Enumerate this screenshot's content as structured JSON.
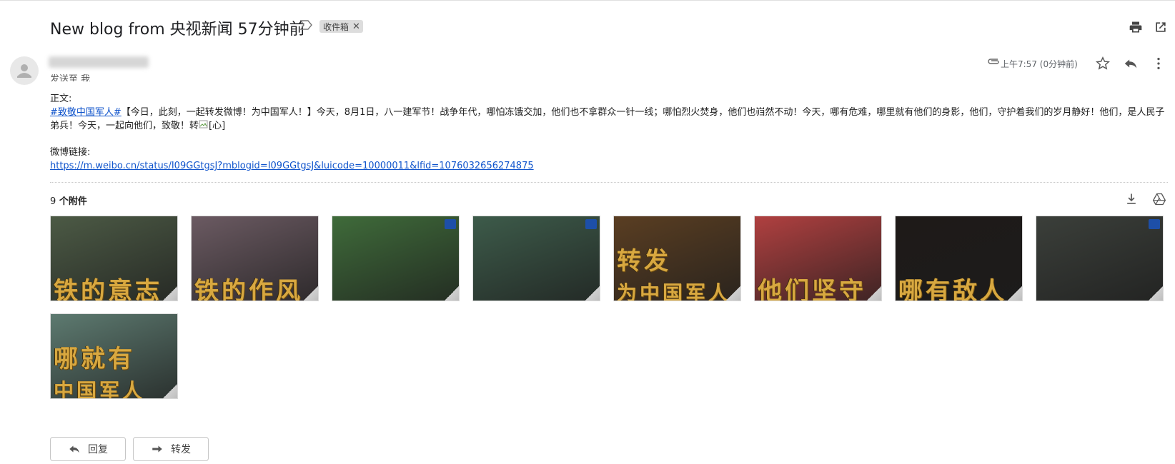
{
  "subject": "New blog from 央视新闻 57分钟前",
  "label_chip": "收件箱",
  "recipient_line": "发送至 我",
  "time": "上午7:57 (0分钟前)",
  "body": {
    "heading": "正文:",
    "hashtag": "#致敬中国军人#",
    "text": "【今日，此刻，一起转发微博！为中国军人！】今天，8月1日，八一建军节！战争年代，哪怕冻饿交加，他们也不拿群众一针一线；哪怕烈火焚身，他们也岿然不动！今天，哪有危难，哪里就有他们的身影，他们，守护着我们的岁月静好！他们，是人民子弟兵！今天，一起向他们，致敬！转",
    "broken_image_alt": "[心]",
    "link_label": "微博链接:",
    "link_url": "https://m.weibo.cn/status/I09GGtgsJ?mblogid=I09GGtgsJ&luicode=10000011&lfid=1076032656274875"
  },
  "attachments": {
    "count": "9",
    "label": "个附件",
    "items": [
      {
        "caption": "铁的意志",
        "bg": "#4c5a45"
      },
      {
        "caption": "铁的作风",
        "bg": "#6b5a62"
      },
      {
        "caption": "",
        "bg": "#3f6b3a"
      },
      {
        "caption": "",
        "bg": "#3d5b4a"
      },
      {
        "caption": "转发",
        "subcaption": "为中国军人",
        "bg": "#5a3e22"
      },
      {
        "caption": "他们坚守",
        "bg": "#b04040"
      },
      {
        "caption": "哪有敌人",
        "bg": "#1e1a18"
      },
      {
        "caption": "",
        "bg": "#3b3f3a"
      },
      {
        "caption": "哪就有",
        "subcaption": "中国军人",
        "bg": "#5d7a70"
      }
    ]
  },
  "actions": {
    "reply": "回复",
    "forward": "转发"
  },
  "colors": {
    "link": "#1155cc",
    "chip_bg": "#dddddd",
    "gold_text": "#d8a840"
  },
  "icons": [
    "importance-marker-icon",
    "print-icon",
    "open-new-window-icon",
    "paperclip-icon",
    "star-icon",
    "reply-icon",
    "more-vert-icon",
    "download-icon",
    "drive-icon",
    "avatar-icon"
  ]
}
